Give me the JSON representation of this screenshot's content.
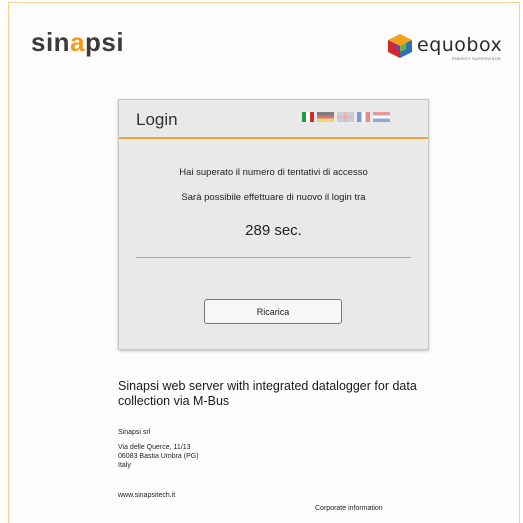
{
  "brand": {
    "sinapsi_prefix": "sin",
    "sinapsi_accent": "a",
    "sinapsi_suffix": "psi",
    "equobox_word": "equobox",
    "equobox_tagline": "ENERGY SUPERVISOR"
  },
  "login": {
    "title": "Login",
    "flags": [
      "italian-flag",
      "german-flag",
      "uk-flag",
      "french-flag",
      "dutch-flag"
    ],
    "message_line1": "Hai superato il numero di tentativi di accesso",
    "message_line2": "Sarà possibile effettuare di nuovo il login tra",
    "countdown": "289 sec.",
    "reload_label": "Ricarica"
  },
  "footer": {
    "headline": "Sinapsi web server with integrated datalogger for data collection via M-Bus",
    "company_name": "Sinapsi srl",
    "address_line1": "Via delle Querce, 11/13",
    "address_line2": "06083 Bastia Umbra (PG)",
    "address_line3": "Italy",
    "website": "www.sinapsitech.it",
    "corporate_link": "Corporate information"
  },
  "colors": {
    "accent_orange": "#f1a430",
    "card_background": "#e9e9e9"
  }
}
